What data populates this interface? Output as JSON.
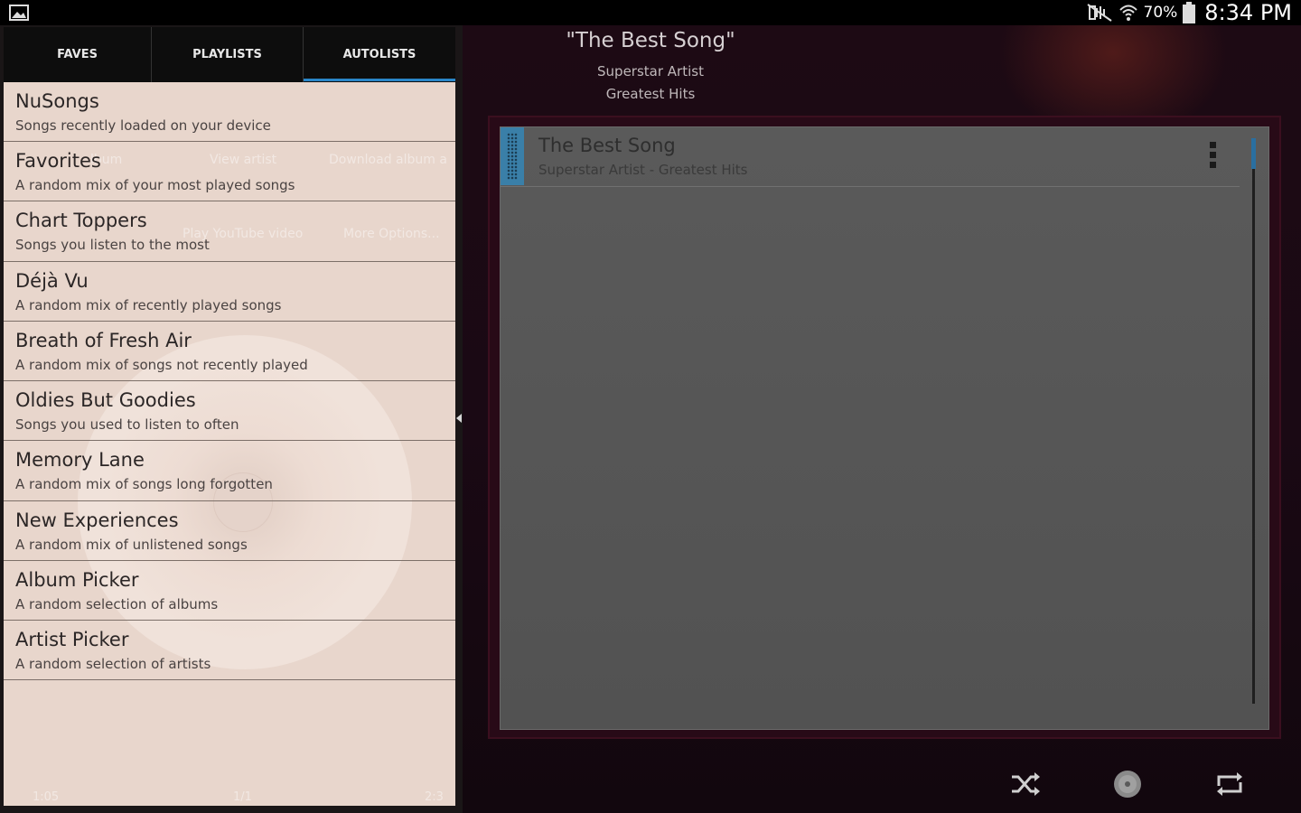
{
  "status_bar": {
    "battery_percent": "70%",
    "time": "8:34 PM",
    "icons": [
      "image-notification-icon",
      "mute-icon",
      "wifi-icon",
      "battery-icon"
    ]
  },
  "now_playing": {
    "title": "\"The Best Song\"",
    "artist": "Superstar Artist",
    "album": "Greatest Hits"
  },
  "tabs": [
    {
      "label": "FAVES",
      "active": false
    },
    {
      "label": "PLAYLISTS",
      "active": false
    },
    {
      "label": "AUTOLISTS",
      "active": true
    }
  ],
  "autolists": [
    {
      "title": "NuSongs",
      "subtitle": "Songs recently loaded on your device"
    },
    {
      "title": "Favorites",
      "subtitle": "A random mix of your most played songs"
    },
    {
      "title": "Chart Toppers",
      "subtitle": "Songs you listen to the most"
    },
    {
      "title": "Déjà Vu",
      "subtitle": "A random mix of recently played songs"
    },
    {
      "title": "Breath of Fresh Air",
      "subtitle": "A random mix of songs not recently played"
    },
    {
      "title": "Oldies But Goodies",
      "subtitle": "Songs you used to listen to often"
    },
    {
      "title": "Memory Lane",
      "subtitle": "A random mix of songs long forgotten"
    },
    {
      "title": "New Experiences",
      "subtitle": "A random mix of unlistened songs"
    },
    {
      "title": "Album Picker",
      "subtitle": "A random selection of albums"
    },
    {
      "title": "Artist Picker",
      "subtitle": "A random selection of artists"
    }
  ],
  "ghost_menu": {
    "album": "lbum",
    "view_artist": "View artist",
    "download_album": "Download album a",
    "play_youtube": "Play YouTube video",
    "more_options": "More Options...",
    "time_elapsed": "1:05",
    "track_count": "1/1",
    "time_total": "2:3"
  },
  "queue": [
    {
      "title": "The Best Song",
      "subtitle": "Superstar Artist - Greatest Hits"
    }
  ],
  "controls": [
    "shuffle-icon",
    "disc-icon",
    "repeat-icon"
  ],
  "colors": {
    "accent": "#2a86c8",
    "list_bg": "#e8d6cc",
    "queue_bg": "#555555"
  }
}
